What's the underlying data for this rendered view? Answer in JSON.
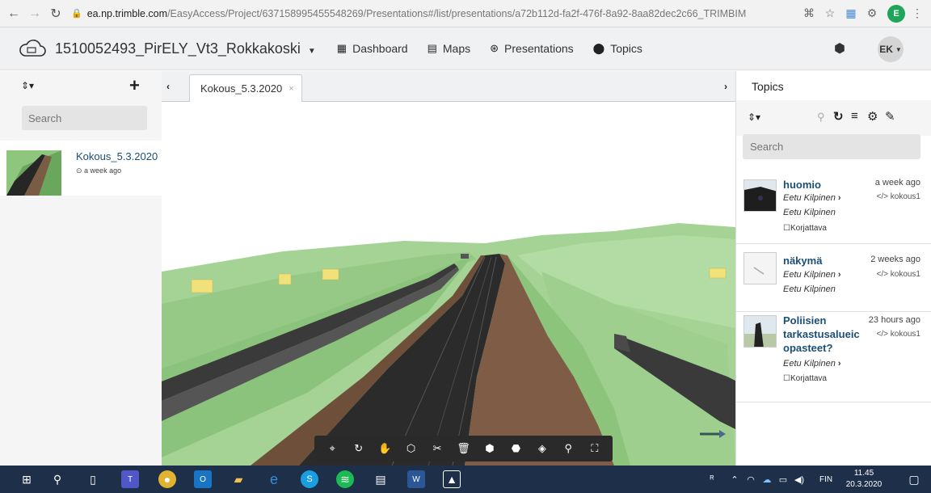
{
  "browser": {
    "url_host": "ea.np.trimble.com",
    "url_path": "/EasyAccess/Project/637158995455548269/Presentations#/list/presentations/a72b112d-fa2f-476f-8a92-8aa82dec2c66_TRIMBIM",
    "profile_initial": "E"
  },
  "header": {
    "project_title": "1510052493_PirELY_Vt3_Rokkakoski",
    "nav": [
      "Dashboard",
      "Maps",
      "Presentations",
      "Topics"
    ],
    "avatar_initials": "EK"
  },
  "left": {
    "search_placeholder": "Search",
    "presentation": {
      "title": "Kokous_5.3.2020",
      "time": "a week ago"
    }
  },
  "tab": {
    "label": "Kokous_5.3.2020"
  },
  "topics": {
    "title": "Topics",
    "search_placeholder": "Search",
    "items": [
      {
        "title": "huomio",
        "date": "a week ago",
        "tag": "</> kokous1",
        "line1": "Eetu Kilpinen",
        "line2": "Eetu Kilpinen",
        "label": "Korjattava"
      },
      {
        "title": "näkymä",
        "date": "2 weeks ago",
        "tag": "</> kokous1",
        "line1": "Eetu Kilpinen",
        "line2": "Eetu Kilpinen",
        "label": ""
      },
      {
        "title_l1": "Poliisien",
        "title_l2": "tarkastusalueic",
        "title_l3": "opasteet?",
        "date": "23 hours ago",
        "tag": "</> kokous1",
        "line1": "Eetu Kilpinen",
        "label": "Korjattava"
      }
    ]
  },
  "taskbar": {
    "lang": "FIN",
    "time": "11.45",
    "date": "20.3.2020"
  },
  "colors": {
    "accent": "#1a4f75",
    "taskbar": "#1e2f4a",
    "terrain": "#9fcf8f",
    "road": "#2d2d2d"
  }
}
